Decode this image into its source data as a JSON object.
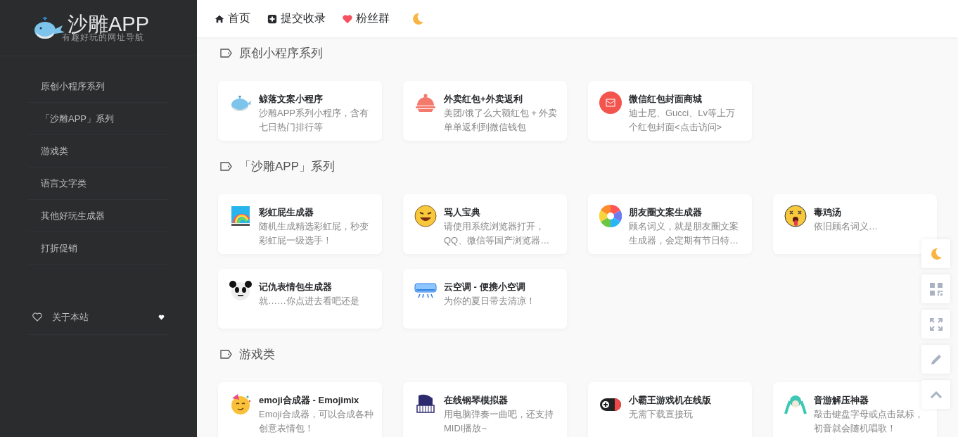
{
  "logo": {
    "title": "沙雕APP",
    "subtitle": "有趣好玩的网址导航"
  },
  "sidebar": {
    "items": [
      {
        "label": "原创小程序系列"
      },
      {
        "label": "「沙雕APP」系列"
      },
      {
        "label": "游戏类"
      },
      {
        "label": "语言文字类"
      },
      {
        "label": "其他好玩生成器"
      },
      {
        "label": "打折促销"
      }
    ],
    "footer_item": {
      "label": "关于本站"
    }
  },
  "header": {
    "nav": [
      {
        "label": "首页"
      },
      {
        "label": "提交收录"
      },
      {
        "label": "粉丝群"
      }
    ]
  },
  "sections": [
    {
      "title": "原创小程序系列",
      "cards": [
        {
          "title": "鲸落文案小程序",
          "description": "沙雕APP系列小程序，含有七日热门排行等"
        },
        {
          "title": "外卖红包+外卖返利",
          "description": "美团/饿了么大额红包 + 外卖单单返利到微信钱包"
        },
        {
          "title": "微信红包封面商城",
          "description": "迪士尼、Gucci、Lv等上万个红包封面<点击访问>"
        }
      ]
    },
    {
      "title": "「沙雕APP」系列",
      "cards": [
        {
          "title": "彩虹屁生成器",
          "description": "随机生成精选彩虹屁，秒变彩虹屁一级选手！"
        },
        {
          "title": "骂人宝典",
          "description": "请使用系统浏览器打开，QQ、微信等国产浏览器…"
        },
        {
          "title": "朋友圈文案生成器",
          "description": "顾名词义，就是朋友圈文案生成器，会定期有节日特…"
        },
        {
          "title": "毒鸡汤",
          "description": "依旧顾名词义…"
        },
        {
          "title": "记仇表情包生成器",
          "description": "就……你点进去看吧还是"
        },
        {
          "title": "云空调 - 便携小空调",
          "description": "为你的夏日带去清凉！"
        }
      ]
    },
    {
      "title": "游戏类",
      "cards": [
        {
          "title": "emoji合成器 - Emojimix",
          "description": "Emoji合成器，可以合成各种创意表情包！"
        },
        {
          "title": "在线钢琴模拟器",
          "description": "用电脑弹奏一曲吧，还支持MIDI播放~"
        },
        {
          "title": "小霸王游戏机在线版",
          "description": "无需下载直接玩"
        },
        {
          "title": "音游解压神器",
          "description": "敲击键盘字母或点击鼠标，初音就会随机唱歌！"
        }
      ]
    }
  ]
}
